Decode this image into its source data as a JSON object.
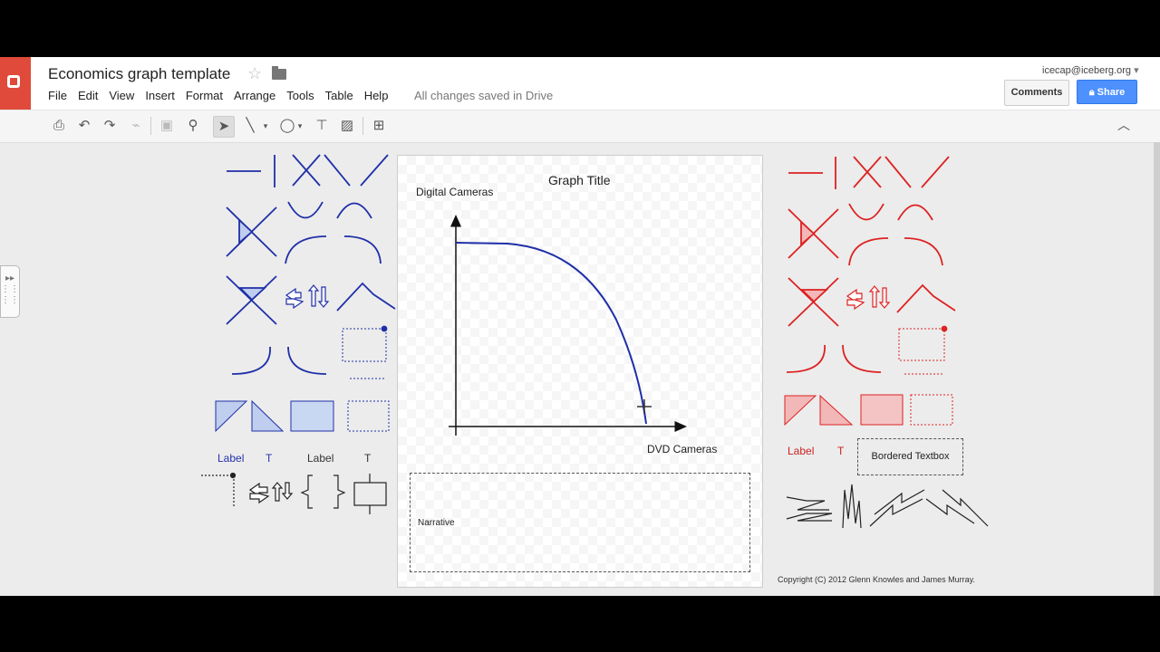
{
  "doc": {
    "title": "Economics graph template",
    "saved_status": "All changes saved in Drive"
  },
  "menu": [
    "File",
    "Edit",
    "View",
    "Insert",
    "Format",
    "Arrange",
    "Tools",
    "Table",
    "Help"
  ],
  "account": {
    "email": "icecap@iceberg.org"
  },
  "buttons": {
    "comments": "Comments",
    "share": "Share"
  },
  "icons": {
    "logo": "drawings-logo",
    "star": "star-icon",
    "folder": "folder-icon",
    "toolbar": [
      "print-icon",
      "undo-icon",
      "redo-icon",
      "paint-format-icon",
      "zoom-fit-icon",
      "zoom-icon",
      "select-arrow-icon",
      "line-icon",
      "shape-icon",
      "textbox-icon",
      "image-icon",
      "add-comment-icon"
    ]
  },
  "graph": {
    "title": "Graph Title",
    "ylabel": "Digital Cameras",
    "xlabel": "DVD Cameras",
    "narrative": "Narrative"
  },
  "palette_left": {
    "label1": "Label",
    "t1": "T",
    "label2": "Label",
    "t2": "T"
  },
  "palette_right": {
    "label": "Label",
    "t": "T",
    "bordered": "Bordered Textbox"
  },
  "copyright": "Copyright (C) 2012 Glenn Knowles and James Murray.",
  "colors": {
    "blue": "#1f2fa8",
    "red": "#dd2222",
    "share": "#4d90fe",
    "logo": "#e04a3a"
  }
}
